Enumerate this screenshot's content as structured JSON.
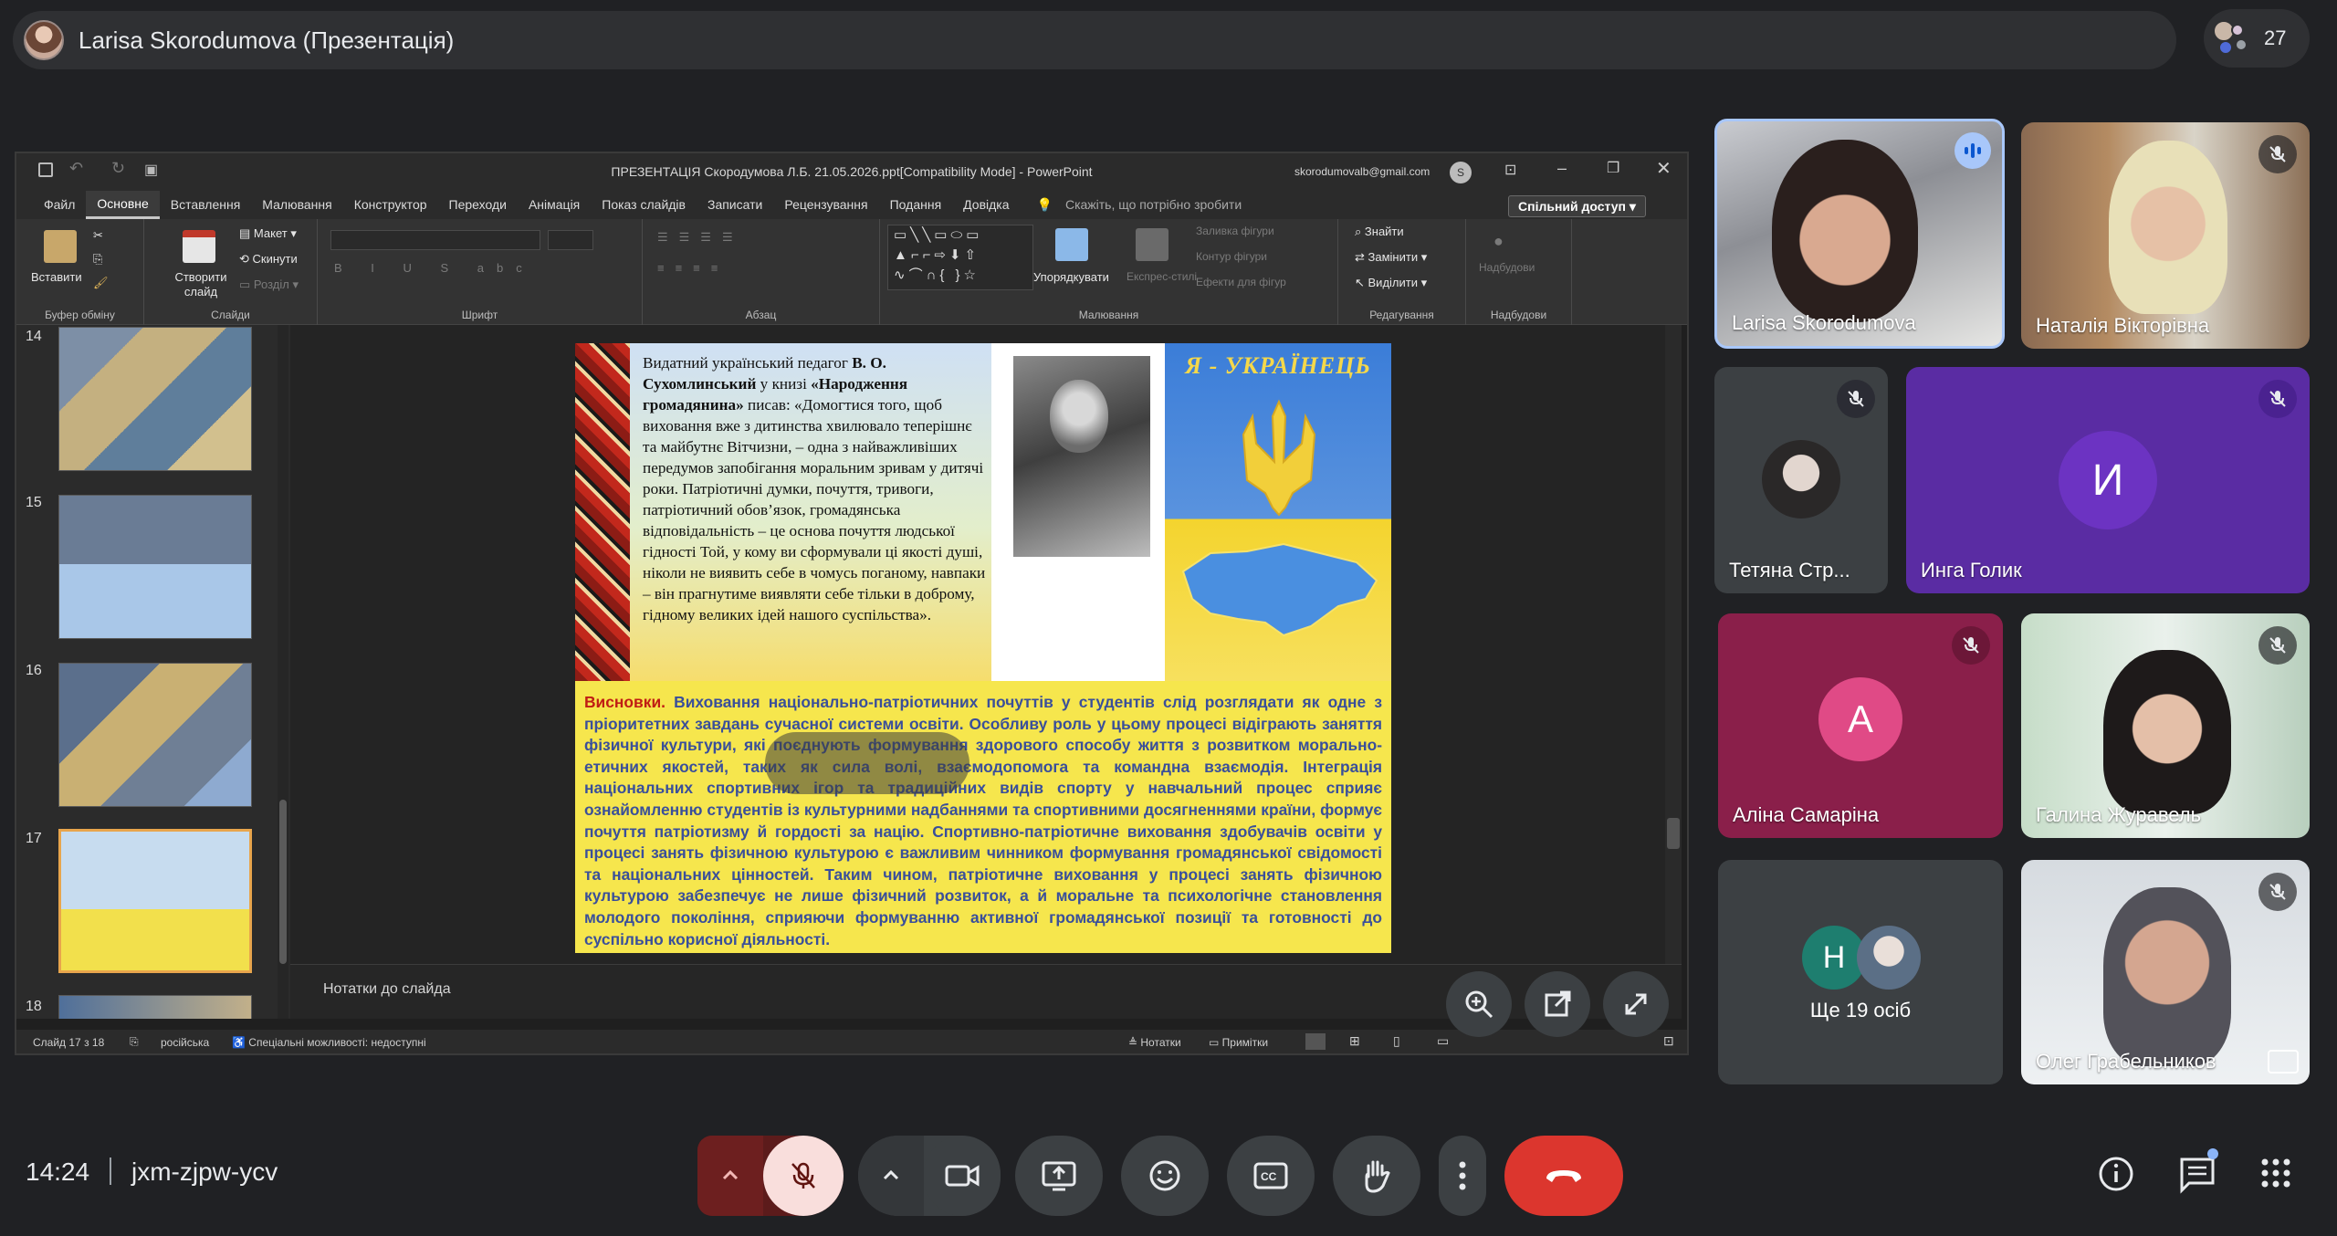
{
  "presenter_bar": {
    "label": "Larisa Skorodumova (Презентація)"
  },
  "participants": {
    "count": "27"
  },
  "powerpoint": {
    "title": "ПРЕЗЕНТАЦІЯ Скородумова Л.Б. 21.05.2026.ppt[Compatibility Mode]  -  PowerPoint",
    "account": "skorodumovalb@gmail.com",
    "tabs": [
      "Файл",
      "Основне",
      "Вставлення",
      "Малювання",
      "Конструктор",
      "Переходи",
      "Анімація",
      "Показ слайдів",
      "Записати",
      "Рецензування",
      "Подання",
      "Довідка"
    ],
    "active_tab": "Основне",
    "tell_me": "Скажіть, що потрібно зробити",
    "share": "Спільний доступ",
    "ribbon": {
      "paste": "Вставити",
      "clipboard_group": "Буфер обміну",
      "new_slide": "Створити слайд",
      "layout": "Макет",
      "reset": "Скинути",
      "section": "Розділ",
      "slides_group": "Слайди",
      "font_group": "Шрифт",
      "paragraph_group": "Абзац",
      "arrange": "Упорядкувати",
      "quick_styles": "Експрес-стилі",
      "shape_fill": "Заливка фігури",
      "shape_outline": "Контур фігури",
      "shape_effects": "Ефекти для фігур",
      "drawing_group": "Малювання",
      "find": "Знайти",
      "replace": "Замінити",
      "select": "Виділити",
      "editing_group": "Редагування",
      "addins": "Надбудови",
      "addins_group": "Надбудови"
    },
    "thumbnails": [
      "14",
      "15",
      "16",
      "17",
      "18"
    ],
    "active_thumbnail": "17",
    "slide": {
      "quote_intro": "Видатний український педагог ",
      "quote_author": "В. О. Сухомлинський",
      "quote_mid": " у книзі ",
      "quote_book": "«Народження громадянина»",
      "quote_body": " писав: «Домогтися того, щоб виховання вже з дитинства хвилювало теперішнє та майбутнє Вітчизни, – одна з найважливіших передумов запобігання моральним зривам у дитячі роки. Патріотичні думки, почуття, тривоги, патріотичний обов’язок, громадянська відповідальність – це основа почуття людської гідності Той, у кому ви сформували ці якості душі, ніколи не виявить себе в чомусь поганому, навпаки – він прагнутиме виявляти себе тільки в доброму, гідному великих ідей нашого суспільства».",
      "flag_title": "Я - УКРАЇНЕЦЬ",
      "conclusion_lead": "Висновки.",
      "conclusion_body": " Виховання національно-патріотичних почуттів у студентів слід розглядати як одне з пріоритетних завдань сучасної системи освіти. Особливу роль у цьому процесі відіграють заняття фізичної культури, які поєднують формування здорового способу життя з розвитком морально-етичних якостей, таких як сила волі, взаємодопомога та командна взаємодія. Інтеграція національних спортивних ігор та традиційних видів спорту у навчальний процес сприяє ознайомленню студентів із культурними надбаннями та спортивними досягненнями країни, формує почуття патріотизму й гордості за націю. Спортивно-патріотичне виховання здобувачів освіти у процесі занять фізичною культурою є важливим чинником формування громадянської свідомості та національних цінностей. Таким чином, патріотичне виховання у процесі занять фізичною культурою забезпечує не лише фізичний розвиток, а й моральне та психологічне становлення молодого покоління, сприяючи формуванню активної громадянської позиції та готовності до суспільно корисної діяльності."
    },
    "notes_placeholder": "Нотатки до слайда",
    "status": {
      "slide_count": "Слайд 17 з 18",
      "language": "російська",
      "accessibility": "Спеціальні можливості: недоступні",
      "notes": "Нотатки",
      "comments": "Примітки"
    }
  },
  "tiles": [
    {
      "name": "Larisa Skorodumova",
      "speaking": true
    },
    {
      "name": "Наталія Вікторівна",
      "muted": true
    },
    {
      "name": "Тетяна Стр...",
      "muted": true
    },
    {
      "name": "Инга Голик",
      "initial": "И",
      "muted": true
    },
    {
      "name": "Аліна Самаріна",
      "initial": "A",
      "muted": true
    },
    {
      "name": "Галина Журавель",
      "muted": true
    },
    {
      "name": "Ще 19 осіб",
      "initial": "H"
    },
    {
      "name": "Олег Грабельников",
      "muted": true
    }
  ],
  "bottom": {
    "time": "14:24",
    "meeting_code": "jxm-zjpw-ycv"
  },
  "colors": {
    "background": "#202124",
    "leave_red": "#ea4335",
    "mic_off_bg": "#f9dedc",
    "tile_purple": "#5a2ca3",
    "tile_pink": "#8a1f4a",
    "initial_teal": "#1e7e6f"
  }
}
